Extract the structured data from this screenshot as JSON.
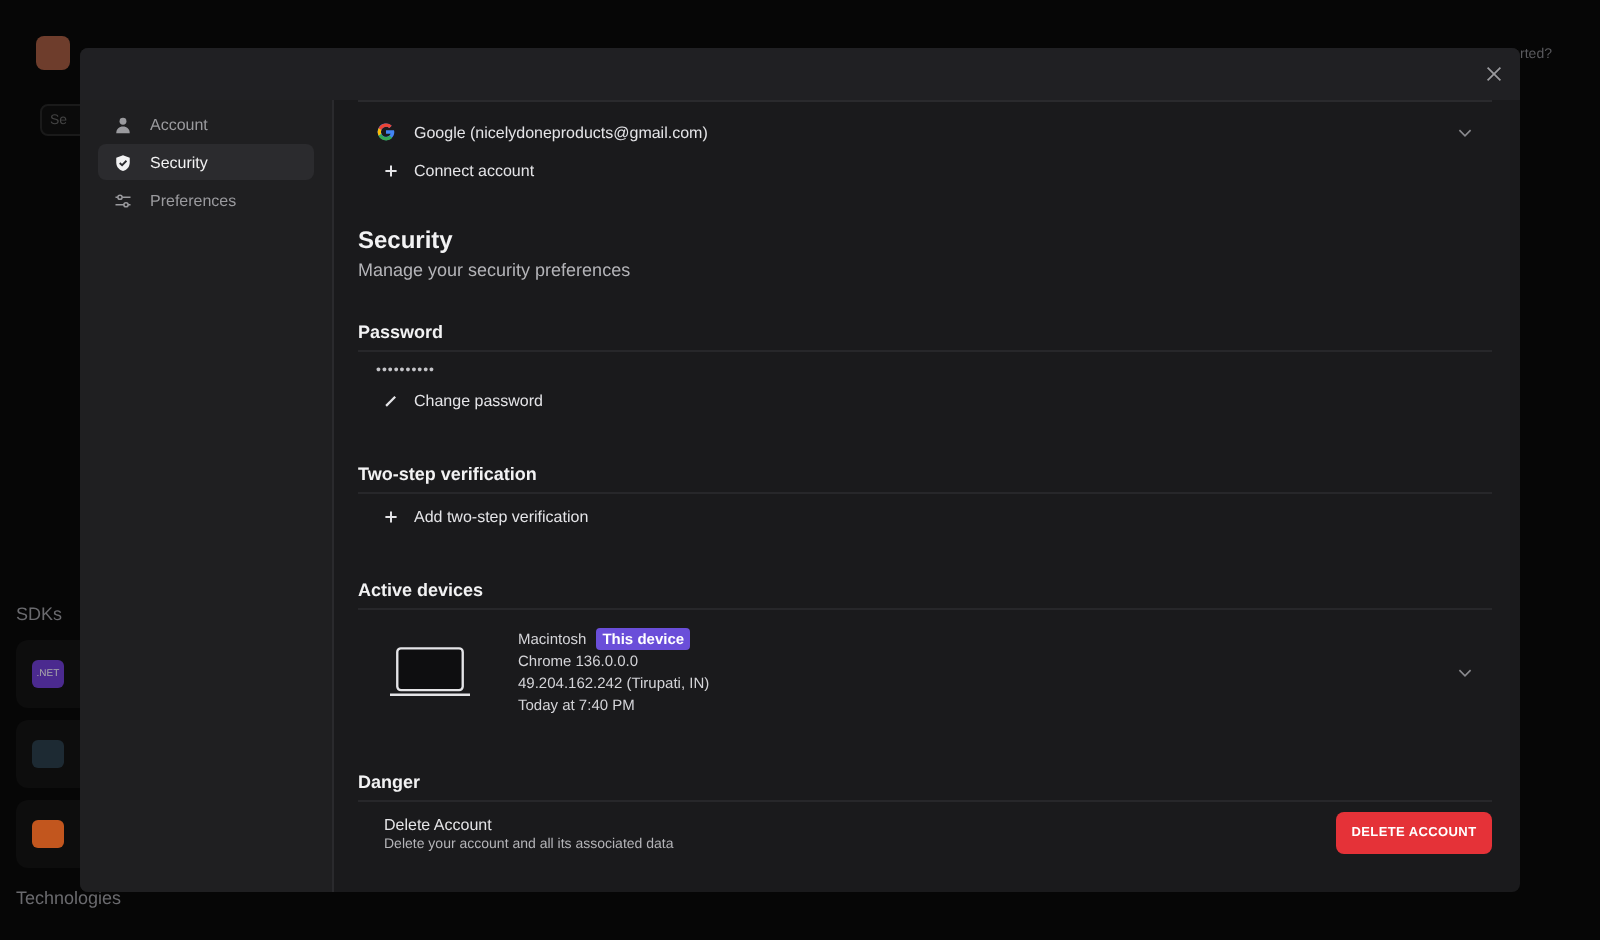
{
  "background": {
    "header_text": "rted?",
    "search_placeholder": "Se",
    "sdks_heading": "SDKs",
    "sdk_badges": [
      {
        "label": ".NET",
        "color": "#4b2a8f"
      },
      {
        "color": "#1d2a33"
      },
      {
        "color": "#c2561e"
      }
    ],
    "technologies_heading": "Technologies"
  },
  "sidebar": {
    "items": [
      {
        "label": "Account",
        "selected": false
      },
      {
        "label": "Security",
        "selected": true
      },
      {
        "label": "Preferences",
        "selected": false
      }
    ]
  },
  "connected_accounts": [
    {
      "label": "Google (nicelydoneproducts@gmail.com)"
    }
  ],
  "connect_account": "Connect account",
  "section": {
    "title": "Security",
    "subtitle": "Manage your security preferences"
  },
  "password": {
    "heading": "Password",
    "masked": "••••••••••",
    "action": "Change password"
  },
  "two_step": {
    "heading": "Two-step verification",
    "action": "Add two-step verification"
  },
  "devices": {
    "heading": "Active devices",
    "items": [
      {
        "name": "Macintosh",
        "badge": "This device",
        "browser": "Chrome 136.0.0.0",
        "ip": "49.204.162.242 (Tirupati, IN)",
        "last_active": "Today at 7:40 PM"
      }
    ]
  },
  "danger": {
    "heading": "Danger",
    "title": "Delete Account",
    "description": "Delete your account and all its associated data",
    "button": "DELETE ACCOUNT"
  }
}
